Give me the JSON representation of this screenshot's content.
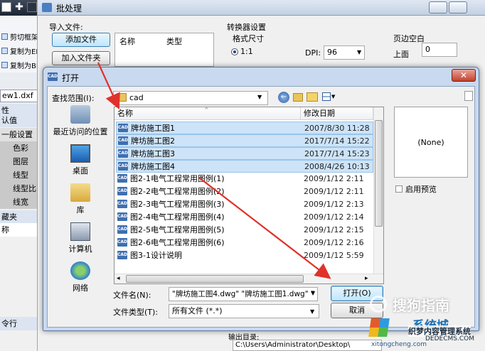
{
  "background_app": {
    "ribbon_items": [
      "剪切框架",
      "复制为EMF",
      "复制为BMP"
    ],
    "filename_tab": "ew1.dxf",
    "property_rows": [
      {
        "label": "性",
        "type": "head"
      },
      {
        "label": "认值",
        "type": "head"
      },
      {
        "label": "一般设置",
        "type": "head"
      },
      {
        "label": "色彩",
        "type": "sub"
      },
      {
        "label": "图层",
        "type": "sub"
      },
      {
        "label": "线型",
        "type": "sub"
      },
      {
        "label": "线型比",
        "type": "sub"
      },
      {
        "label": "线宽",
        "type": "sub"
      },
      {
        "label": "藏夹",
        "type": "head"
      },
      {
        "label": "称",
        "type": "plain"
      }
    ],
    "bottom_tab": "令行"
  },
  "batch_window": {
    "title": "批处理",
    "import_files_label": "导入文件:",
    "add_file_button": "添加文件",
    "add_folder_button": "加入文件夹",
    "list_columns": [
      "名称",
      "类型"
    ],
    "converter_settings_label": "转换器设置",
    "format_size_label": "格式尺寸",
    "ratio_option": "1:1",
    "dpi_label": "DPI:",
    "dpi_value": "96",
    "margin_label": "页边空白",
    "top_label": "上面",
    "top_value": "0",
    "output_dir_label": "输出目录:",
    "output_path": "C:\\Users\\Administrator\\Desktop\\"
  },
  "open_dialog": {
    "title": "打开",
    "look_in_label": "查找范围(I):",
    "look_in_value": "cad",
    "places": [
      {
        "label": "最近访问的位置",
        "icon": "recent-places-icon"
      },
      {
        "label": "桌面",
        "icon": "desktop-icon"
      },
      {
        "label": "库",
        "icon": "libraries-icon"
      },
      {
        "label": "计算机",
        "icon": "computer-icon"
      },
      {
        "label": "网络",
        "icon": "network-icon"
      }
    ],
    "columns": {
      "name": "名称",
      "modified": "修改日期"
    },
    "files": [
      {
        "name": "牌坊施工图1",
        "date": "2007/8/30 11:28",
        "selected": true
      },
      {
        "name": "牌坊施工图2",
        "date": "2017/7/14 15:22",
        "selected": true
      },
      {
        "name": "牌坊施工图3",
        "date": "2017/7/14 15:23",
        "selected": true
      },
      {
        "name": "牌坊施工图4",
        "date": "2008/4/26 10:13",
        "selected": true
      },
      {
        "name": "图2-1电气工程常用图例(1)",
        "date": "2009/1/12 2:11",
        "selected": false
      },
      {
        "name": "图2-2电气工程常用图例(2)",
        "date": "2009/1/12 2:11",
        "selected": false
      },
      {
        "name": "图2-3电气工程常用图例(3)",
        "date": "2009/1/12 2:13",
        "selected": false
      },
      {
        "name": "图2-4电气工程常用图例(4)",
        "date": "2009/1/12 2:14",
        "selected": false
      },
      {
        "name": "图2-5电气工程常用图例(5)",
        "date": "2009/1/12 2:15",
        "selected": false
      },
      {
        "name": "图2-6电气工程常用图例(6)",
        "date": "2009/1/12 2:16",
        "selected": false
      },
      {
        "name": "图3-1设计说明",
        "date": "2009/1/12 5:59",
        "selected": false
      }
    ],
    "preview_text": "(None)",
    "enable_preview_label": "启用预览",
    "file_name_label": "文件名(N):",
    "file_name_value": "\"牌坊施工图4.dwg\" \"牌坊施工图1.dwg\" \"",
    "file_type_label": "文件类型(T):",
    "file_type_value": "所有文件 (*.*)",
    "open_button": "打开(O)",
    "cancel_button": "取消",
    "cad_icon_text": "CAD"
  },
  "watermark": {
    "sogou": "搜狗指南",
    "site_name": "织梦内容管理系统",
    "site_url": "DEDECMS.COM",
    "xitong": "系统城",
    "xitong_url": "xitongcheng.com"
  },
  "colors": {
    "selection": "#cde3f8",
    "arrow": "#e0312a",
    "title_accent": "#3f6fb0"
  }
}
